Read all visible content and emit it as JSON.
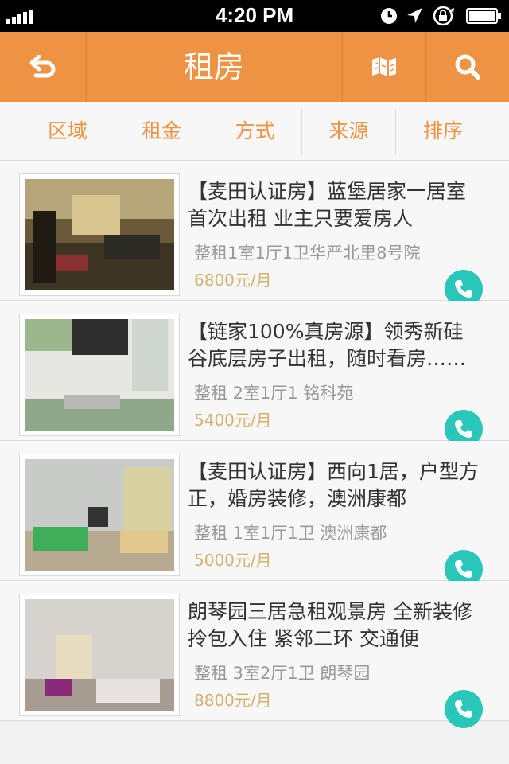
{
  "status_bar": {
    "time": "4:20 PM"
  },
  "navbar": {
    "title": "租房",
    "back_icon": "back-arrow-icon",
    "map_icon": "map-icon",
    "search_icon": "search-icon"
  },
  "filters": [
    "区域",
    "租金",
    "方式",
    "来源",
    "排序"
  ],
  "listings": [
    {
      "title": "【麦田认证房】蓝堡居家一居室首次出租 业主只要爱房人",
      "meta": "整租1室1厅1卫华严北里8号院",
      "price": "6800元/月"
    },
    {
      "title": "【链家100%真房源】领秀新硅谷底层房子出租，随时看房……",
      "meta": "整租 2室1厅1  铭科苑",
      "price": "5400元/月"
    },
    {
      "title": "【麦田认证房】西向1居，户型方正，婚房装修，澳洲康都",
      "meta": "整租 1室1厅1卫  澳洲康都",
      "price": "5000元/月"
    },
    {
      "title": "朗琴园三居急租观景房 全新装修 拎包入住 紧邻二环 交通便",
      "meta": "整租 3室2厅1卫  朗琴园",
      "price": "8800元/月"
    }
  ],
  "colors": {
    "accent": "#ee9244",
    "call": "#29c7b9",
    "price": "#d4b06d"
  }
}
